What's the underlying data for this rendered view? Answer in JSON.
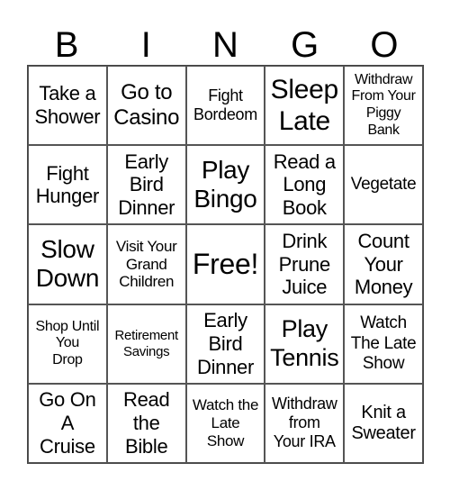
{
  "header": [
    "B",
    "I",
    "N",
    "G",
    "O"
  ],
  "cells": [
    "Take a\nShower",
    "Go to\nCasino",
    "Fight\nBordeom",
    "Sleep\nLate",
    "Withdraw\nFrom Your\nPiggy\nBank",
    "Fight\nHunger",
    "Early\nBird\nDinner",
    "Play\nBingo",
    "Read a\nLong\nBook",
    "Vegetate",
    "Slow\nDown",
    "Visit Your\nGrand\nChildren",
    "Free!",
    "Drink\nPrune\nJuice",
    "Count\nYour\nMoney",
    "Shop Until\nYou\nDrop",
    "Retirement\nSavings",
    "Early\nBird\nDinner",
    "Play\nTennis",
    "Watch\nThe Late\nShow",
    "Go On\nA\nCruise",
    "Read\nthe\nBible",
    "Watch the\nLate\nShow",
    "Withdraw\nfrom\nYour IRA",
    "Knit a\nSweater"
  ]
}
